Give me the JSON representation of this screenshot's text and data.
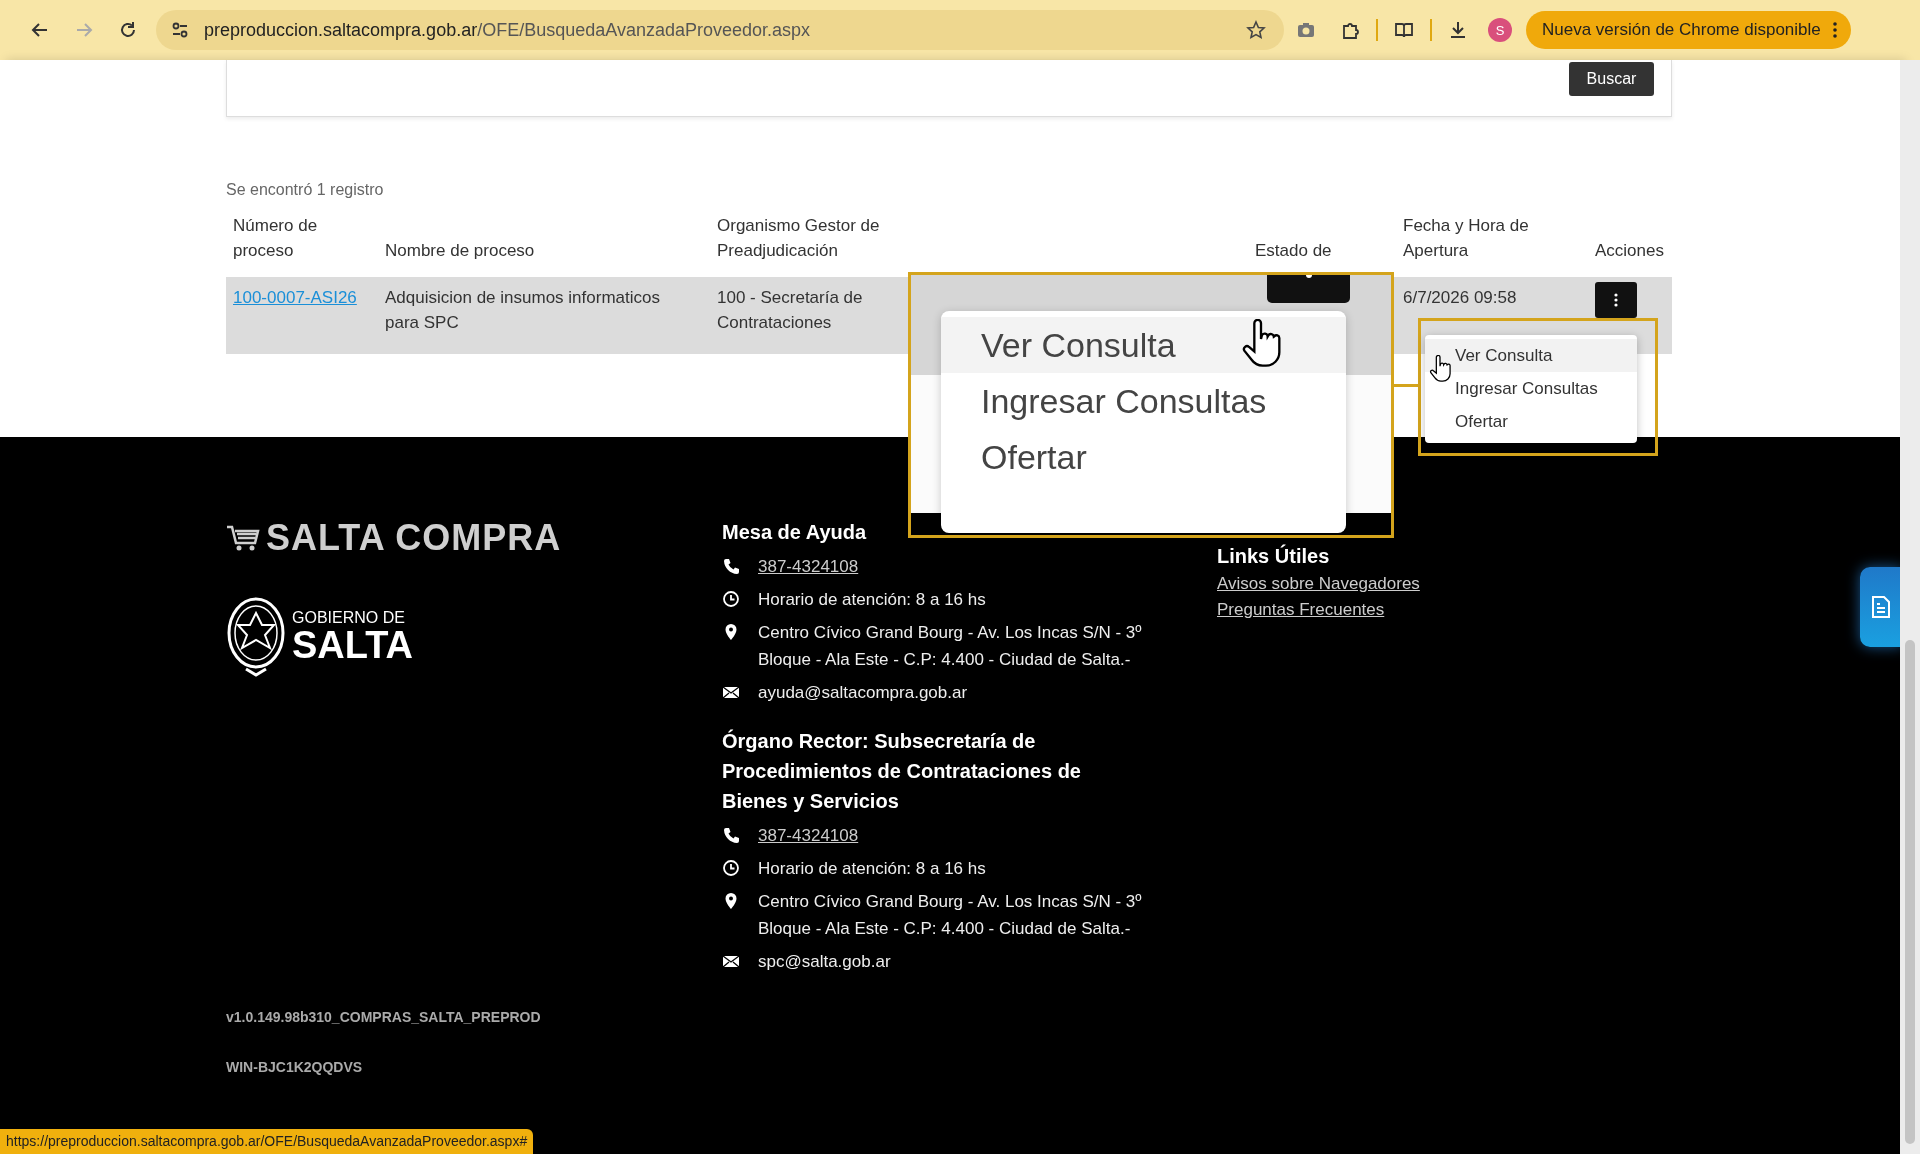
{
  "browser": {
    "url_host": "preproduccion.saltacompra.gob.ar",
    "url_path": "/OFE/BusquedaAvanzadaProveedor.aspx",
    "forward_disabled": true,
    "profile_initial": "S",
    "update_button": "Nueva versión de Chrome disponible"
  },
  "search_card": {
    "button": "Buscar"
  },
  "results": {
    "count_text": "Se encontró 1 registro",
    "columns": [
      "Número de proceso",
      "Nombre de proceso",
      "Organismo Gestor de Preadjudicación",
      "Estado de",
      "Fecha y Hora de Apertura",
      "Acciones"
    ],
    "rows": [
      {
        "number": "100-0007-ASI26",
        "name": "Adquisicion de insumos informaticos para SPC",
        "organism": "100 - Secretaría de Contrataciones",
        "opening": "6/7/2026 09:58"
      }
    ]
  },
  "actions_menu": {
    "items": [
      {
        "label": "Ver Consulta",
        "hovered": true
      },
      {
        "label": "Ingresar Consultas",
        "hovered": false
      },
      {
        "label": "Ofertar",
        "hovered": false
      }
    ]
  },
  "magnifier": {
    "items": [
      {
        "label": "Ver Consulta",
        "hovered": true
      },
      {
        "label": "Ingresar Consultas",
        "hovered": false
      },
      {
        "label": "Ofertar",
        "hovered": false
      }
    ]
  },
  "footer": {
    "brand": "SALTA COMPRA",
    "gov_top": "GOBIERNO DE",
    "gov_bottom": "SALTA",
    "contacts": [
      {
        "title": "Mesa de Ayuda",
        "lines": [
          {
            "kind": "phone",
            "text": "387-4324108"
          },
          {
            "kind": "hours",
            "text": "Horario de atención: 8 a 16 hs"
          },
          {
            "kind": "address",
            "text": "Centro Cívico Grand Bourg - Av. Los Incas S/N - 3º Bloque - Ala Este - C.P: 4.400 - Ciudad de Salta.-"
          },
          {
            "kind": "email",
            "text": "ayuda@saltacompra.gob.ar"
          }
        ]
      },
      {
        "title": "Órgano Rector: Subsecretaría de Procedimientos de Contrataciones de Bienes y Servicios",
        "lines": [
          {
            "kind": "phone",
            "text": "387-4324108"
          },
          {
            "kind": "hours",
            "text": "Horario de atención: 8 a 16 hs"
          },
          {
            "kind": "address",
            "text": "Centro Cívico Grand Bourg - Av. Los Incas S/N - 3º Bloque - Ala Este - C.P: 4.400 - Ciudad de Salta.-"
          },
          {
            "kind": "email",
            "text": "spc@salta.gob.ar"
          }
        ]
      }
    ],
    "links_title": "Links Útiles",
    "links": [
      "Avisos sobre Navegadores",
      "Preguntas Frecuentes"
    ],
    "version": "v1.0.149.98b310_COMPRAS_SALTA_PREPROD",
    "server": "WIN-BJC1K2QQDVS"
  },
  "status_url": "https://preproduccion.saltacompra.gob.ar/OFE/BusquedaAvanzadaProveedor.aspx#"
}
